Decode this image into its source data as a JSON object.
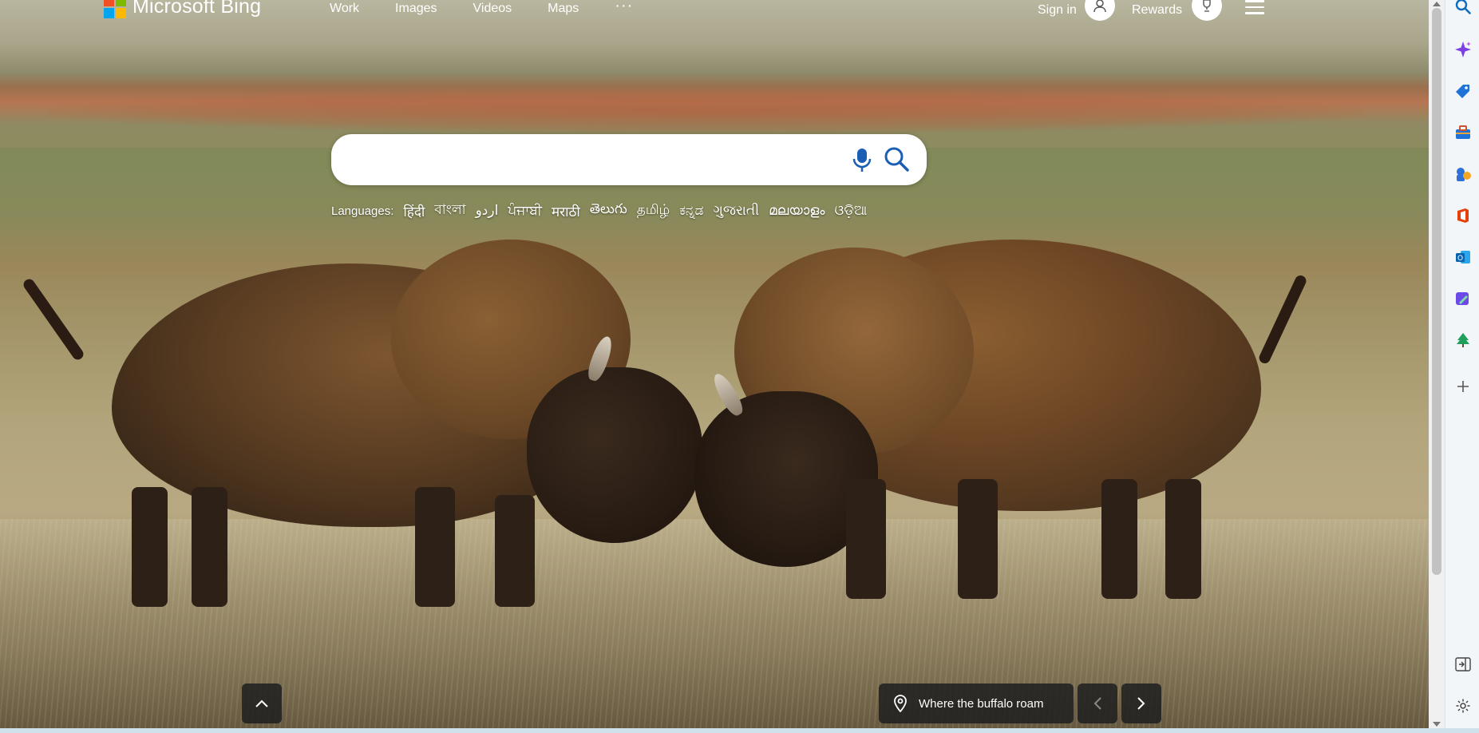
{
  "brand": {
    "name": "Microsoft Bing",
    "logo_colors": [
      "#f25022",
      "#7fba00",
      "#00a4ef",
      "#ffb900"
    ]
  },
  "nav": {
    "items": [
      {
        "label": "Work"
      },
      {
        "label": "Images"
      },
      {
        "label": "Videos"
      },
      {
        "label": "Maps"
      }
    ],
    "more_label": "···"
  },
  "account": {
    "signin_label": "Sign in",
    "rewards_label": "Rewards"
  },
  "search": {
    "value": "",
    "placeholder": "",
    "mic_icon": "microphone-icon",
    "search_icon": "search-icon"
  },
  "languages": {
    "label": "Languages:",
    "items": [
      "हिंदी",
      "বাংলা",
      "اردو",
      "ਪੰਜਾਬੀ",
      "मराठी",
      "తెలుగు",
      "தமிழ்",
      "ಕನ್ನಡ",
      "ગુજરાતી",
      "മലയാളം",
      "ଓଡ଼ିଆ"
    ]
  },
  "image_caption": {
    "text": "Where the buffalo roam",
    "icon": "location-pin-icon"
  },
  "sidebar": {
    "icons": [
      "search-icon",
      "copilot-icon",
      "shopping-tag-icon",
      "tools-icon",
      "games-icon",
      "office-icon",
      "outlook-icon",
      "designer-icon",
      "tree-icon",
      "add-icon"
    ],
    "bottom_icons": [
      "panel-toggle-icon",
      "settings-icon"
    ]
  },
  "colors": {
    "accent_blue": "#0f6cbd",
    "search_icon": "#1a5fb4"
  }
}
